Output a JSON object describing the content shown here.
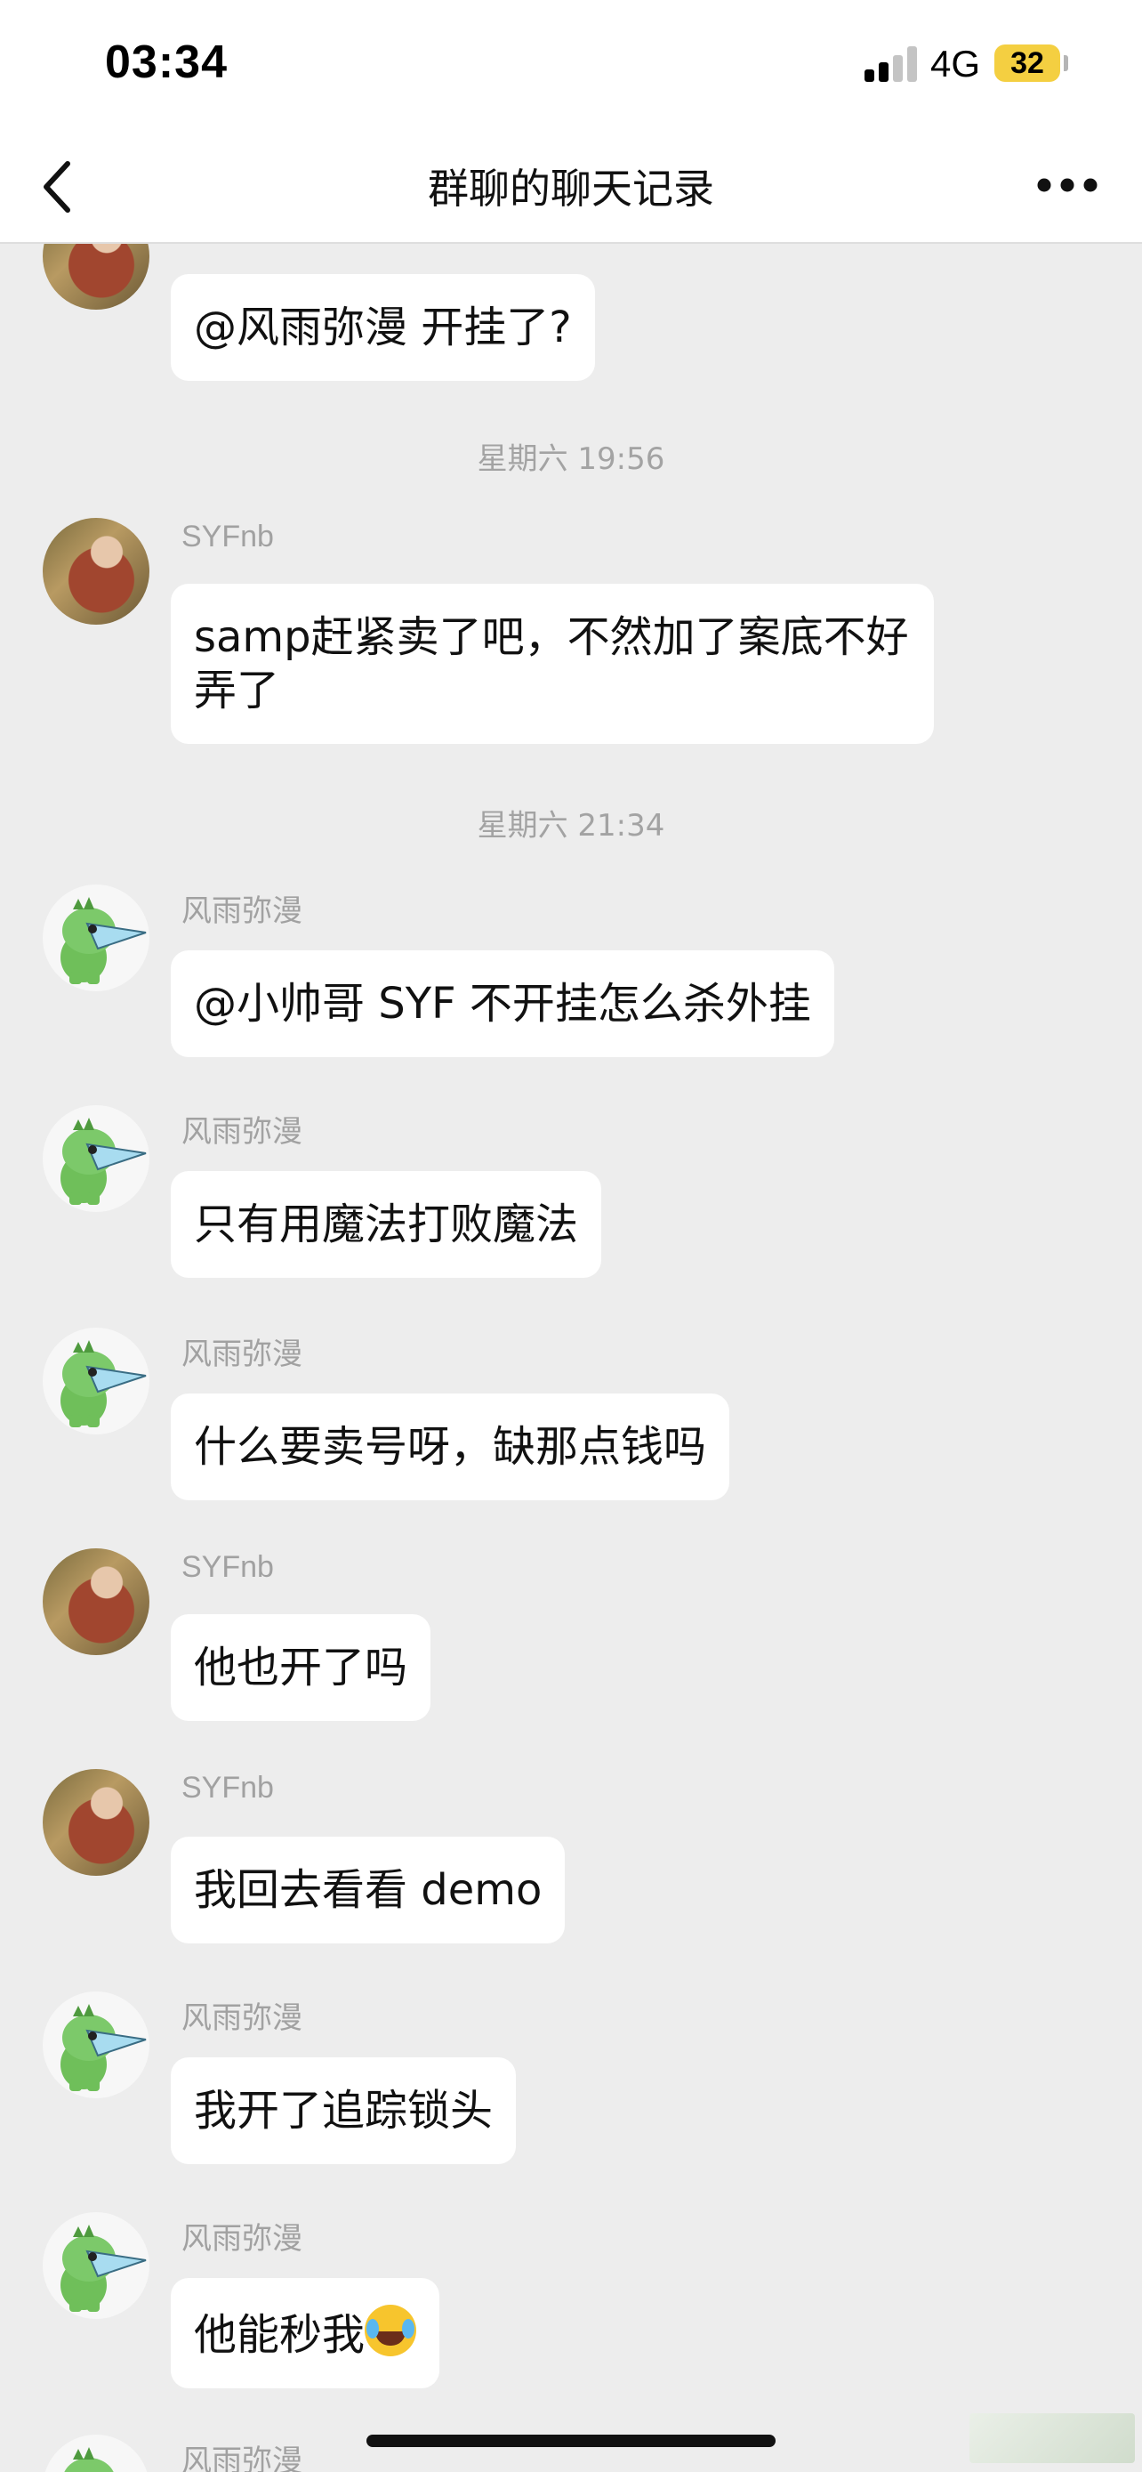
{
  "status_bar": {
    "time": "03:34",
    "network": "4G",
    "battery": "32"
  },
  "nav": {
    "title": "群聊的聊天记录"
  },
  "chat": {
    "messages": [
      {
        "text": "@风雨弥漫 开挂了?"
      },
      {
        "timestamp": "星期六 19:56"
      },
      {
        "sender": "SYFnb",
        "text": "samp赶紧卖了吧，不然加了案底不好弄了"
      },
      {
        "timestamp": "星期六 21:34"
      },
      {
        "sender": "风雨弥漫",
        "text": "@小帅哥 SYF 不开挂怎么杀外挂"
      },
      {
        "sender": "风雨弥漫",
        "text": "只有用魔法打败魔法"
      },
      {
        "sender": "风雨弥漫",
        "text": "什么要卖号呀，缺那点钱吗"
      },
      {
        "sender": "SYFnb",
        "text": "他也开了吗"
      },
      {
        "sender": "SYFnb",
        "text": "我回去看看 demo"
      },
      {
        "sender": "风雨弥漫",
        "text": "我开了追踪锁头"
      },
      {
        "sender": "风雨弥漫",
        "text": "他能秒我",
        "emoji": "tears-of-joy-emoji"
      },
      {
        "sender": "风雨弥漫"
      }
    ]
  },
  "icons": {
    "back": "chevron-left-icon",
    "more": "more-dots-icon",
    "signal": "cellular-signal-icon",
    "battery": "battery-icon"
  },
  "colors": {
    "background": "#ededed",
    "bubble": "#ffffff",
    "battery": "#f4cf41",
    "muted_text": "#a3a3a3"
  }
}
